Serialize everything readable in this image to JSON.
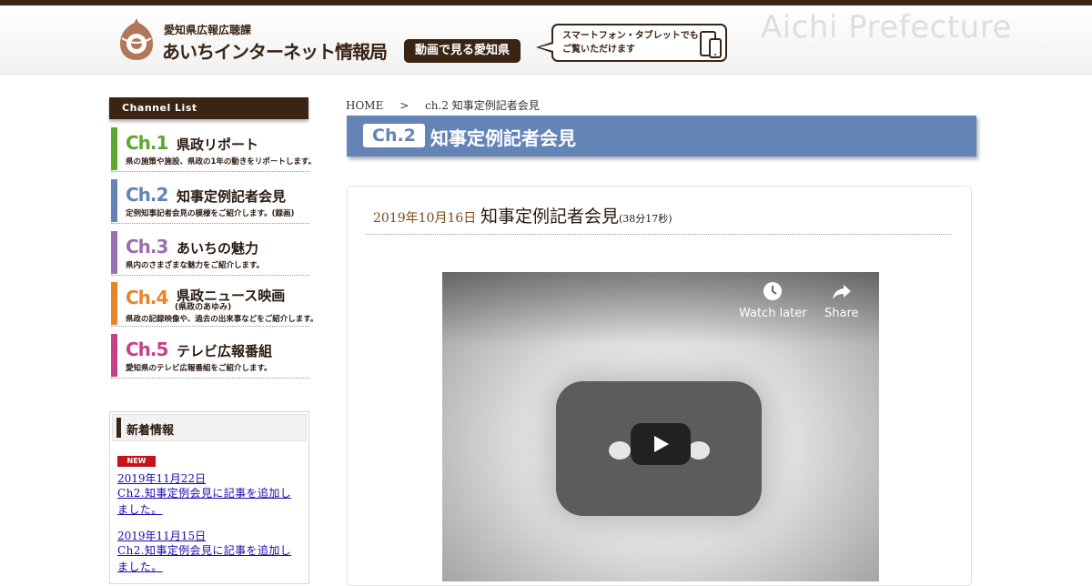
{
  "header": {
    "department": "愛知県広報広聴課",
    "site_title": "あいちインターネット情報局",
    "video_pill": "動画で見る愛知県",
    "bubble_line1": "スマートフォン・タブレットでも",
    "bubble_line2": "ご覧いただけます",
    "pref_name": "Aichi Prefecture"
  },
  "sidebar": {
    "channel_heading": "Channel List",
    "channels": [
      {
        "num": "Ch.1",
        "name": "県政リポート",
        "sub": "",
        "desc": "県の施策や施設、県政の1年の動きをリポートします。",
        "color": "#5aa830"
      },
      {
        "num": "Ch.2",
        "name": "知事定例記者会見",
        "sub": "",
        "desc": "定例知事記者会見の模様をご紹介します。(録画)",
        "color": "#6484b8"
      },
      {
        "num": "Ch.3",
        "name": "あいちの魅力",
        "sub": "",
        "desc": "県内のさまざまな魅力をご紹介します。",
        "color": "#9a6fb0"
      },
      {
        "num": "Ch.4",
        "name": "県政ニュース映画",
        "sub": "(県政のあゆみ)",
        "desc": "県政の記録映像や、過去の出来事などをご紹介します。",
        "color": "#e8842a"
      },
      {
        "num": "Ch.5",
        "name": "テレビ広報番組",
        "sub": "",
        "desc": "愛知県のテレビ広報番組をご紹介します。",
        "color": "#c6418a"
      }
    ],
    "news": {
      "heading": "新着情報",
      "badge": "NEW",
      "items": [
        {
          "date": "2019年11月22日",
          "text": "Ch2.知事定例会見に記事を追加しました。"
        },
        {
          "date": "2019年11月15日",
          "text": "Ch2.知事定例会見に記事を追加しました。"
        }
      ]
    }
  },
  "main": {
    "breadcrumb": {
      "home": "HOME",
      "sep": ">",
      "current": "ch.2 知事定例記者会見"
    },
    "banner": {
      "ch": "Ch.2",
      "title": "知事定例記者会見"
    },
    "post": {
      "date": "2019年10月16日",
      "title": "知事定例記者会見",
      "duration": "(38分17秒)"
    },
    "video": {
      "watch_later": "Watch later",
      "share": "Share"
    }
  },
  "colors": {
    "brand_brown": "#3a2414",
    "ch2_blue": "#6484b8",
    "new_red": "#c3141b"
  }
}
